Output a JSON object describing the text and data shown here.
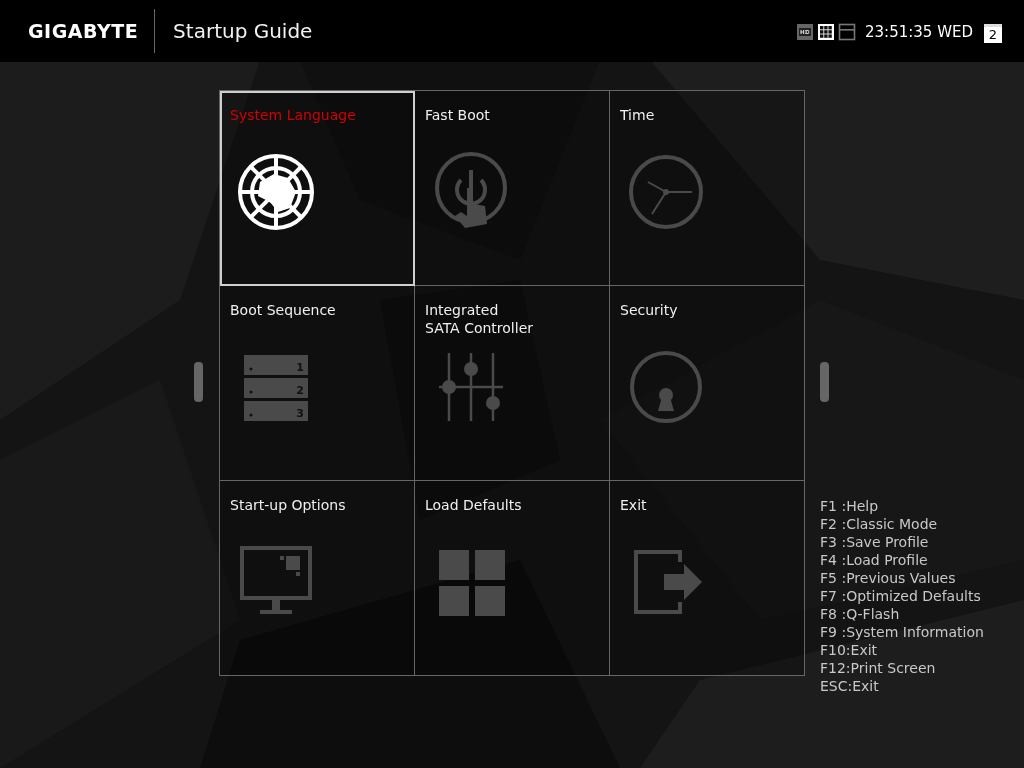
{
  "header": {
    "brand": "GIGABYTE",
    "title": "Startup Guide",
    "view_modes": [
      {
        "kind": "hd",
        "selected": false
      },
      {
        "kind": "grid",
        "selected": true
      },
      {
        "kind": "single",
        "selected": false
      }
    ],
    "time": "23:51:35 WED",
    "calendar_day": "2"
  },
  "tiles": [
    {
      "title": "System Language",
      "kind": "globe",
      "selected": true
    },
    {
      "title": "Fast Boot",
      "kind": "power",
      "selected": false
    },
    {
      "title": "Time",
      "kind": "clock",
      "selected": false
    },
    {
      "title": "Boot Sequence",
      "kind": "stack",
      "selected": false,
      "icon_labels": [
        "1",
        "2",
        "3"
      ]
    },
    {
      "title": "Integrated\nSATA Controller",
      "kind": "sliders",
      "selected": false
    },
    {
      "title": "Security",
      "kind": "lock",
      "selected": false
    },
    {
      "title": "Start-up Options",
      "kind": "monitor",
      "selected": false
    },
    {
      "title": "Load Defaults",
      "kind": "squares",
      "selected": false
    },
    {
      "title": "Exit",
      "kind": "exit",
      "selected": false
    }
  ],
  "hotkeys": [
    "F1 :Help",
    "F2 :Classic Mode",
    "F3 :Save Profile",
    "F4 :Load Profile",
    "F5 :Previous Values",
    "F7 :Optimized Defaults",
    "F8 :Q-Flash",
    "F9 :System Information",
    "F10:Exit",
    "F12:Print Screen",
    "ESC:Exit"
  ]
}
